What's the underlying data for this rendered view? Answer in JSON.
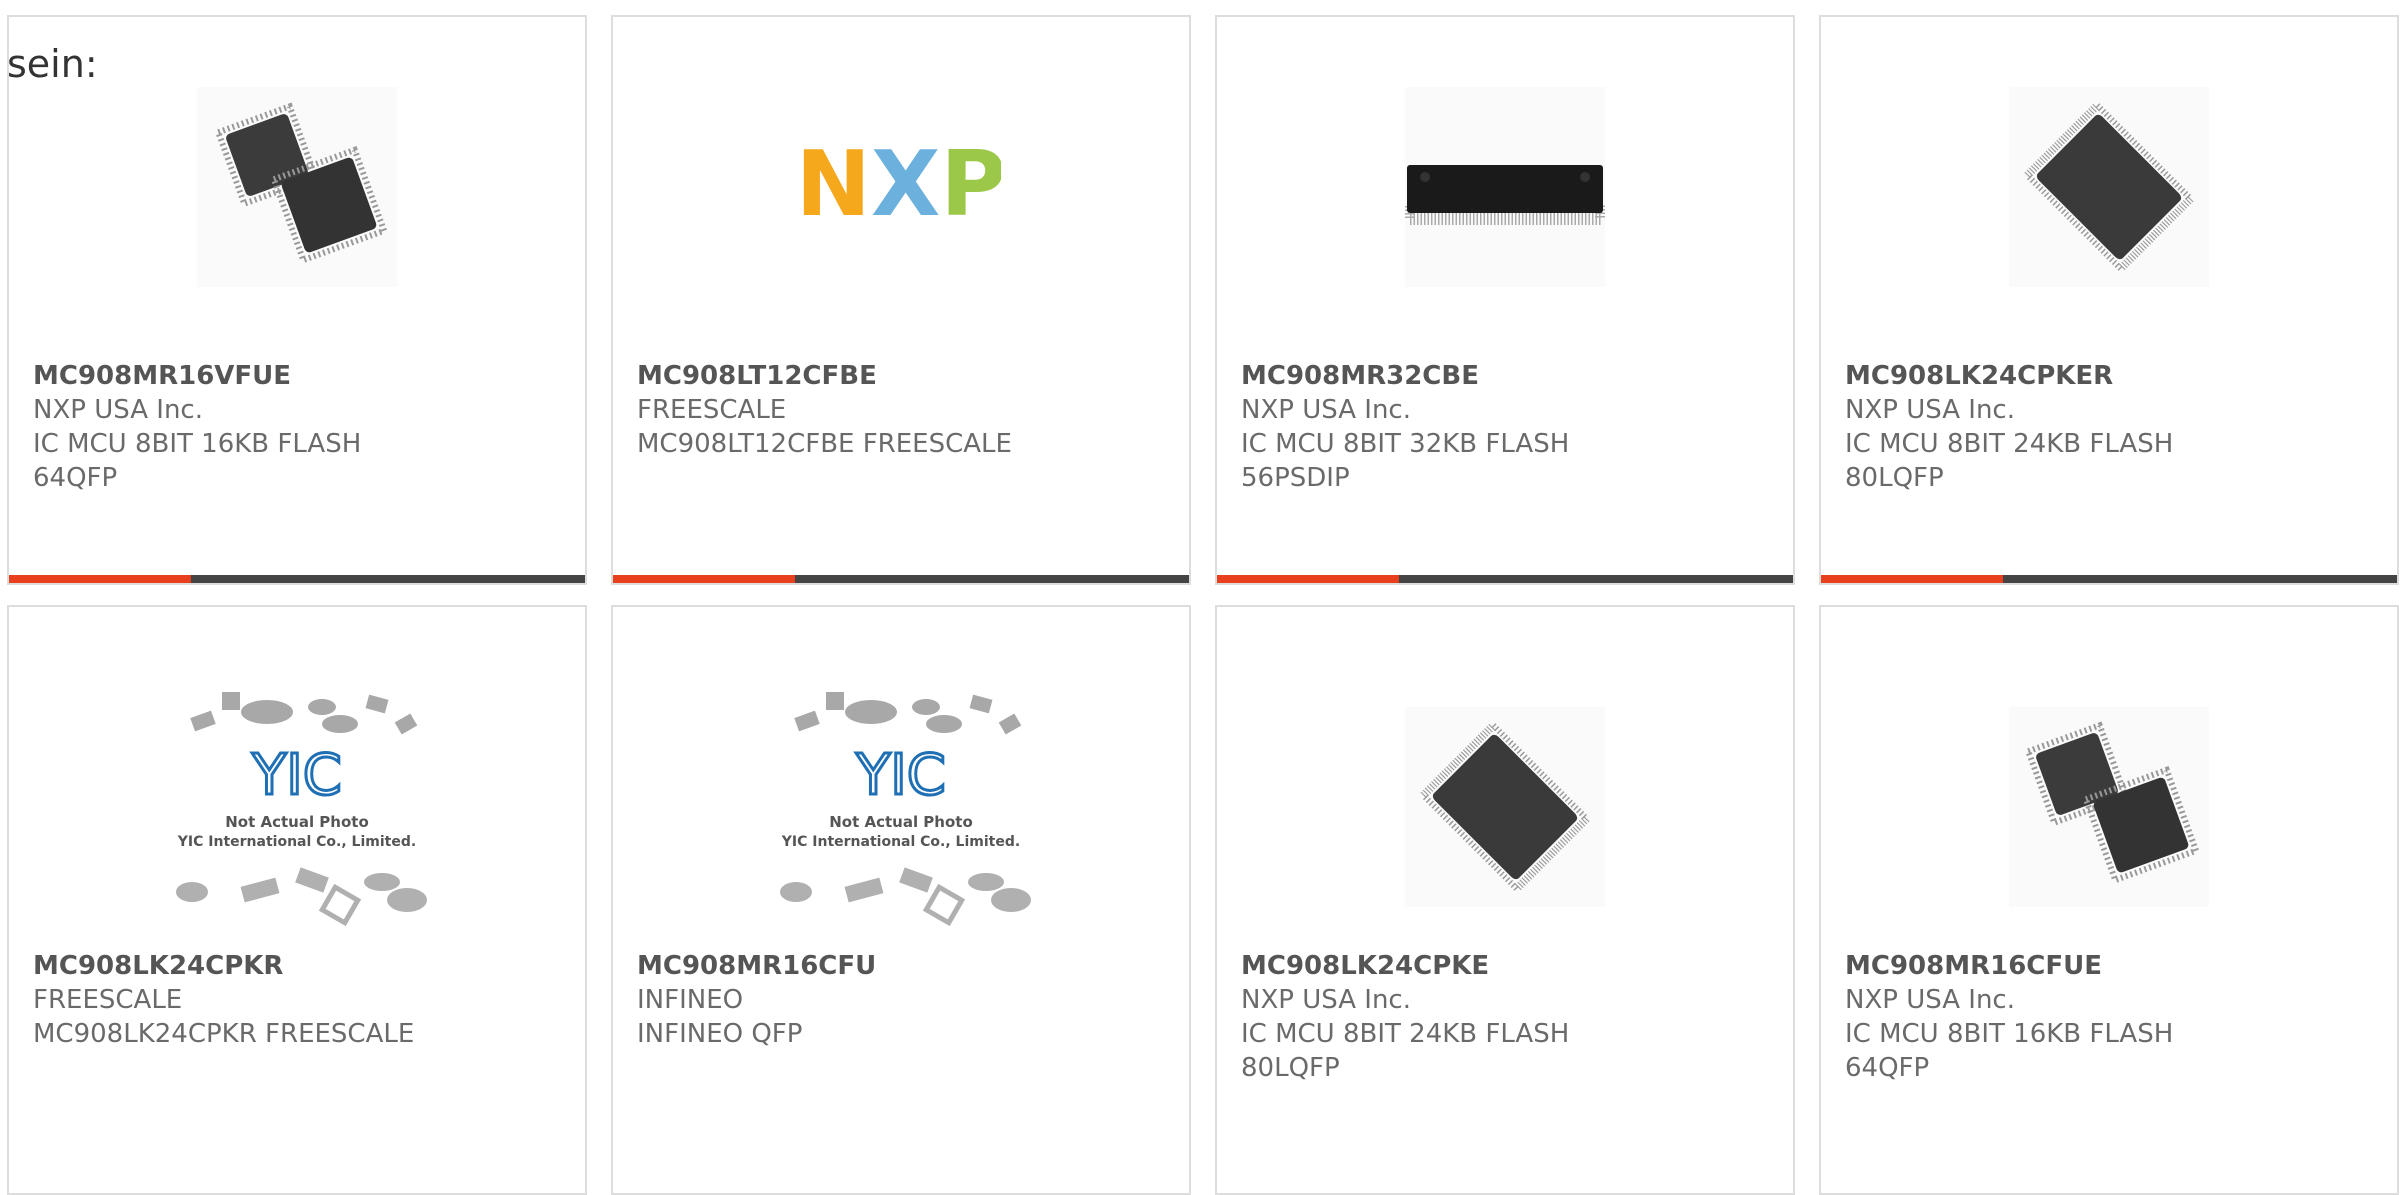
{
  "intro_text": "sein:",
  "colors": {
    "accent": "#e8401c",
    "bar": "#444444",
    "border": "#dddddd",
    "text": "#6a6a6a"
  },
  "products": [
    {
      "part_number": "MC908MR16VFUE",
      "manufacturer": "NXP USA Inc.",
      "description": "IC MCU 8BIT 16KB FLASH 64QFP",
      "image": "two-qfp-chips"
    },
    {
      "part_number": "MC908LT12CFBE",
      "manufacturer": "FREESCALE",
      "description": "MC908LT12CFBE FREESCALE",
      "image": "nxp-logo",
      "logo_text": "NXP"
    },
    {
      "part_number": "MC908MR32CBE",
      "manufacturer": "NXP USA Inc.",
      "description": "IC MCU 8BIT 32KB FLASH 56PSDIP",
      "image": "dip-chip"
    },
    {
      "part_number": "MC908LK24CPKER",
      "manufacturer": "NXP USA Inc.",
      "description": "IC MCU 8BIT 24KB FLASH 80LQFP",
      "image": "lqfp-chip"
    },
    {
      "part_number": "MC908LK24CPKR",
      "manufacturer": "FREESCALE",
      "description": "MC908LK24CPKR FREESCALE",
      "image": "not-actual-photo",
      "placeholder_logo": "YIC",
      "placeholder_line1": "Not Actual Photo",
      "placeholder_line2": "YIC International Co., Limited."
    },
    {
      "part_number": "MC908MR16CFU",
      "manufacturer": "INFINEO",
      "description": "INFINEO QFP",
      "image": "not-actual-photo",
      "placeholder_logo": "YIC",
      "placeholder_line1": "Not Actual Photo",
      "placeholder_line2": "YIC International Co., Limited."
    },
    {
      "part_number": "MC908LK24CPKE",
      "manufacturer": "NXP USA Inc.",
      "description": "IC MCU 8BIT 24KB FLASH 80LQFP",
      "image": "lqfp-chip"
    },
    {
      "part_number": "MC908MR16CFUE",
      "manufacturer": "NXP USA Inc.",
      "description": "IC MCU 8BIT 16KB FLASH 64QFP",
      "image": "two-qfp-chips"
    }
  ]
}
